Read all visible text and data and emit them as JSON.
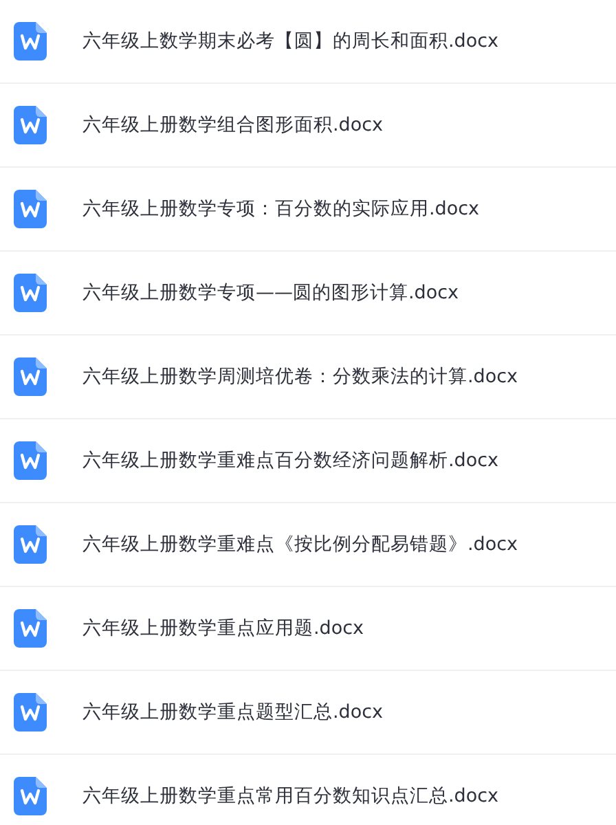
{
  "files": [
    {
      "name": "六年级上数学期末必考【圆】的周长和面积.docx",
      "kind": "word"
    },
    {
      "name": "六年级上册数学组合图形面积.docx",
      "kind": "word"
    },
    {
      "name": "六年级上册数学专项：百分数的实际应用.docx",
      "kind": "word"
    },
    {
      "name": "六年级上册数学专项——圆的图形计算.docx",
      "kind": "word"
    },
    {
      "name": "六年级上册数学周测培优卷：分数乘法的计算.docx",
      "kind": "word"
    },
    {
      "name": "六年级上册数学重难点百分数经济问题解析.docx",
      "kind": "word"
    },
    {
      "name": "六年级上册数学重难点《按比例分配易错题》.docx",
      "kind": "word"
    },
    {
      "name": "六年级上册数学重点应用题.docx",
      "kind": "word"
    },
    {
      "name": "六年级上册数学重点题型汇总.docx",
      "kind": "word"
    },
    {
      "name": "六年级上册数学重点常用百分数知识点汇总.docx",
      "kind": "word"
    }
  ]
}
